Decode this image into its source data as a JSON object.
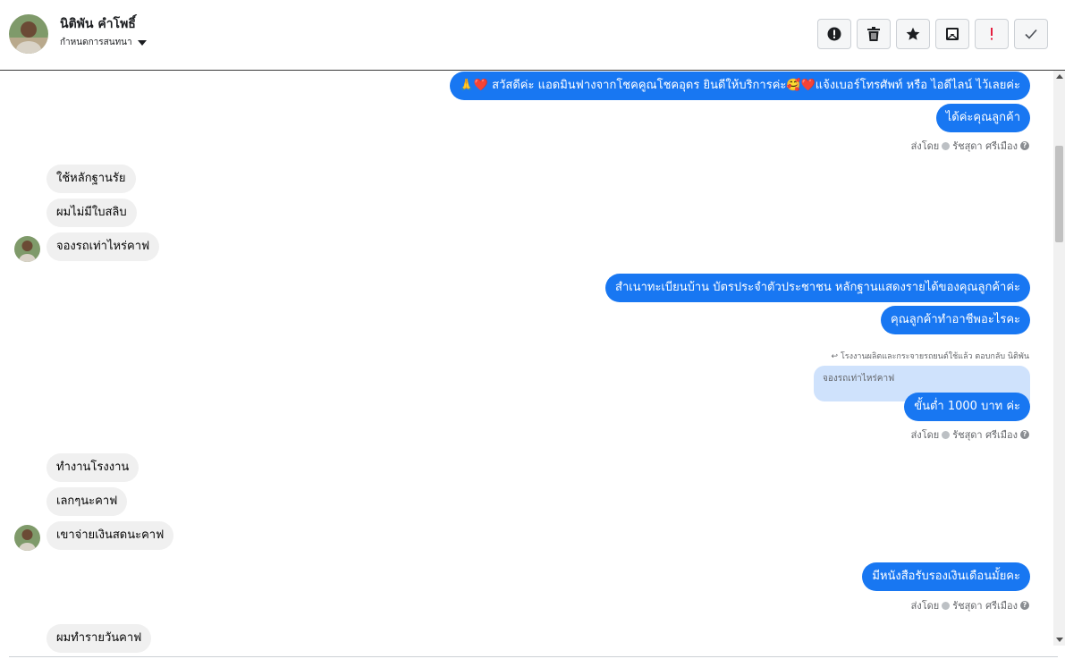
{
  "header": {
    "contact_name": "นิติพัน คำโพธิ์",
    "conversation_label": "กำหนดการสนทนา"
  },
  "toolbar": {
    "buttons": [
      {
        "icon": "alert-circle-icon"
      },
      {
        "icon": "trash-icon"
      },
      {
        "icon": "star-icon"
      },
      {
        "icon": "mark-unread-icon"
      },
      {
        "icon": "exclamation-icon"
      },
      {
        "icon": "check-icon"
      }
    ]
  },
  "messages": [
    {
      "dir": "out",
      "text": "🙏❤️ สวัสดีค่ะ แอดมินฟางจากโชคคูณโชคอุดร ยินดีให้บริการค่ะ🥰❤️แจ้งเบอร์โทรศัพท์ หรือ ไอดีไลน์  ไว้เลยค่ะ"
    },
    {
      "dir": "out",
      "text": "ได้ค่ะคุณลูกค้า"
    },
    {
      "meta": "ส่งโดย",
      "sender": "รัชสุดา ศรีเมือง"
    },
    {
      "dir": "in",
      "text": "ใช้หลักฐานรัย"
    },
    {
      "dir": "in",
      "text": "ผมไม่มีใบสลิบ"
    },
    {
      "dir": "in",
      "text": "จองรถเท่าไหร่คาฟ"
    },
    {
      "dir": "out",
      "text": "สำเนาทะเบียนบ้าน บัตรประจำตัวประชาชน หลักฐานแสดงรายได้ของคุณลูกค้าค่ะ"
    },
    {
      "dir": "out",
      "text": "คุณลูกค้าทำอาชีพอะไรคะ"
    },
    {
      "reply_note": "โรงงานผลิตและกระจายรถยนต์ใช้แล้ว ตอบกลับ นิติพัน"
    },
    {
      "quoted": "จองรถเท่าไหร่คาฟ"
    },
    {
      "dir": "out",
      "text": "ขั้นต่ำ 1000 บาท  ค่ะ"
    },
    {
      "meta": "ส่งโดย",
      "sender": "รัชสุดา ศรีเมือง"
    },
    {
      "dir": "in",
      "text": "ทำงานโรงงาน"
    },
    {
      "dir": "in",
      "text": "เลกๆนะคาฟ"
    },
    {
      "dir": "in",
      "text": "เขาจ่ายเงินสดนะคาฟ"
    },
    {
      "dir": "out",
      "text": "มีหนังสือรับรองเงินเดือนมั้ยคะ"
    },
    {
      "meta": "ส่งโดย",
      "sender": "รัชสุดา ศรีเมือง"
    },
    {
      "dir": "in",
      "text": "ผมทำรายวันคาฟ"
    }
  ],
  "colors": {
    "outgoing_bubble": "#1877f2",
    "incoming_bubble": "#f0f0f0",
    "quoted_bg": "#cfe2fc"
  }
}
